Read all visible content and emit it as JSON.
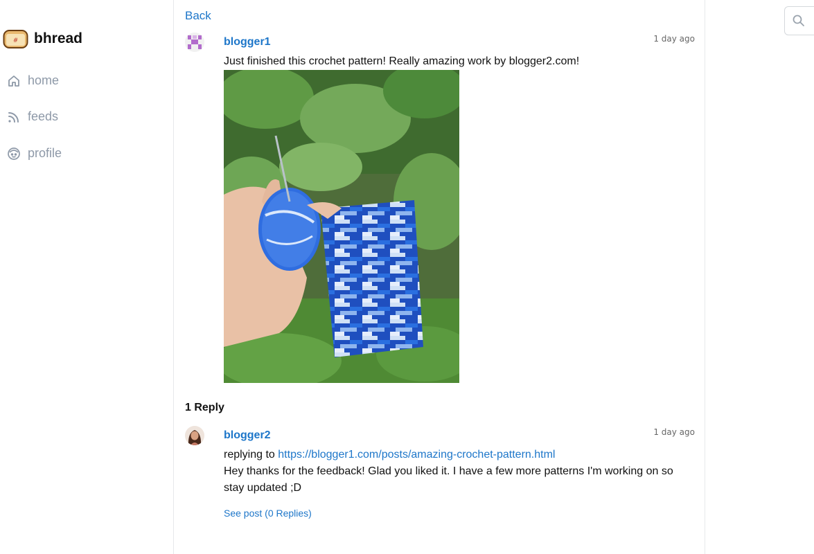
{
  "brand": {
    "name": "bhread",
    "logo_icon": "bread-logo"
  },
  "sidebar": {
    "items": [
      {
        "label": "home",
        "icon": "home-icon"
      },
      {
        "label": "feeds",
        "icon": "rss-icon"
      },
      {
        "label": "profile",
        "icon": "face-icon"
      }
    ]
  },
  "main": {
    "back_label": "Back",
    "post": {
      "author": "blogger1",
      "timestamp": "1 day ago",
      "text": "Just finished this crochet pattern! Really amazing work by blogger2.com!"
    },
    "replies_heading": "1 Reply",
    "reply": {
      "author": "blogger2",
      "timestamp": "1 day ago",
      "replying_to_prefix": "replying to",
      "replying_to_url": "https://blogger1.com/posts/amazing-crochet-pattern.html",
      "text": "Hey thanks for the feedback! Glad you liked it. I have a few more patterns I'm working on so stay updated ;D",
      "see_post_label": "See post (0 Replies)"
    }
  },
  "search": {
    "icon": "search-icon"
  },
  "colors": {
    "link": "#1d76c9",
    "nav": "#8e99a8",
    "border": "#e6e8eb"
  }
}
